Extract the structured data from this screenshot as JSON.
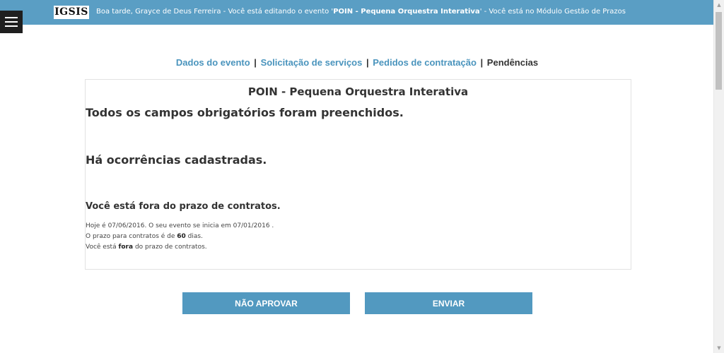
{
  "header": {
    "logo": "IGSIS",
    "greeting_prefix": "Boa tarde, Grayce de Deus Ferreira - Você está editando o evento '",
    "event_name": "POIN - Pequena Orquestra Interativa",
    "greeting_suffix": "' - Você está no Módulo Gestão de Prazos"
  },
  "nav": {
    "items": [
      {
        "label": "Dados do evento"
      },
      {
        "label": "Solicitação de serviços"
      },
      {
        "label": "Pedidos de contratação"
      }
    ],
    "separator": "|",
    "current": "Pendências"
  },
  "panel": {
    "title": "POIN - Pequena Orquestra Interativa",
    "msg_fields": "Todos os campos obrigatórios foram preenchidos.",
    "msg_occurrences": "Há ocorrências cadastradas.",
    "msg_deadline": "Você está fora do prazo de contratos.",
    "detail_line1": "Hoje é 07/06/2016. O seu evento se inicia em 07/01/2016 .",
    "detail_line2_prefix": "O prazo para contratos é de ",
    "detail_days": "60",
    "detail_line2_suffix": " dias.",
    "detail_line3_prefix": "Você está ",
    "detail_status": "fora",
    "detail_line3_suffix": " do prazo de contratos."
  },
  "buttons": {
    "reject": "NÃO APROVAR",
    "send": "ENVIAR"
  },
  "colors": {
    "topbar": "#5a9ec4",
    "link": "#4a94bd",
    "button": "#5299c0"
  }
}
